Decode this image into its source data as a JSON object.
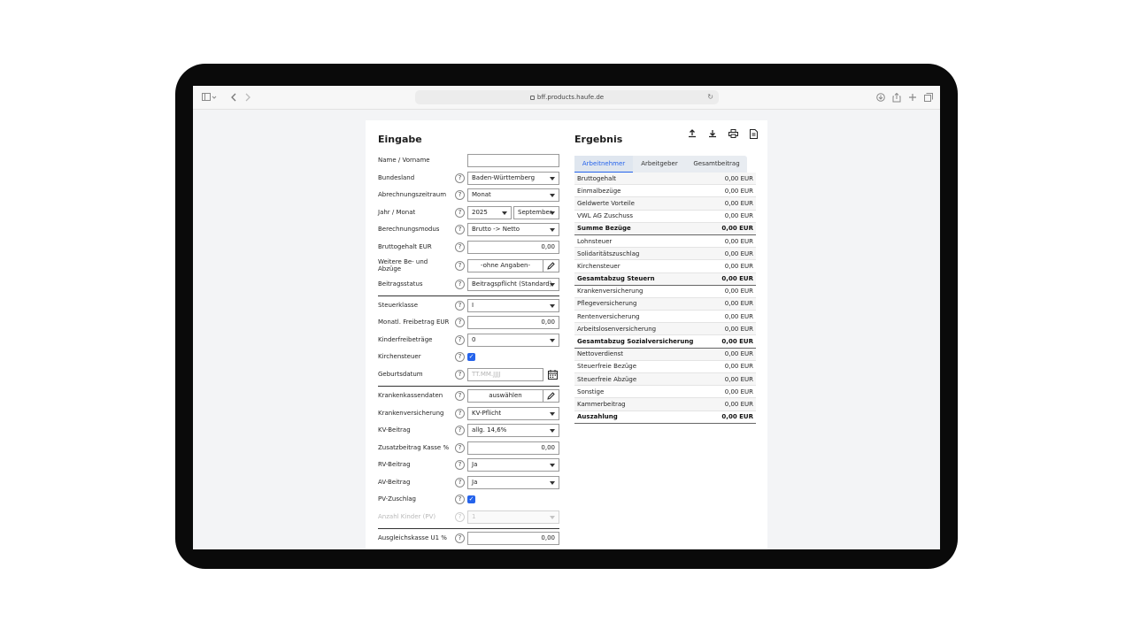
{
  "browser": {
    "url": "bff.products.haufe.de"
  },
  "input_section": {
    "title": "Eingabe",
    "fields": {
      "name": {
        "label": "Name / Vorname",
        "value": ""
      },
      "bundesland": {
        "label": "Bundesland",
        "value": "Baden-Württemberg"
      },
      "abrechnungszeitraum": {
        "label": "Abrechnungszeitraum",
        "value": "Monat"
      },
      "jahr_monat": {
        "label": "Jahr / Monat",
        "year": "2025",
        "month": "September"
      },
      "berechnungsmodus": {
        "label": "Berechnungsmodus",
        "value": "Brutto -> Netto"
      },
      "bruttogehalt": {
        "label": "Bruttogehalt EUR",
        "value": "0,00"
      },
      "weitere": {
        "label": "Weitere Be- und Abzüge",
        "value": "-ohne Angaben-"
      },
      "beitragsstatus": {
        "label": "Beitragsstatus",
        "value": "Beitragspflicht (Standard)"
      },
      "steuerklasse": {
        "label": "Steuerklasse",
        "value": "I"
      },
      "freibetrag": {
        "label": "Monatl. Freibetrag EUR",
        "value": "0,00"
      },
      "kinderfreibetraege": {
        "label": "Kinderfreibeträge",
        "value": "0"
      },
      "kirchensteuer": {
        "label": "Kirchensteuer",
        "checked": true
      },
      "geburtsdatum": {
        "label": "Geburtsdatum",
        "placeholder": "TT.MM.JJJJ"
      },
      "krankenkassendaten": {
        "label": "Krankenkassendaten",
        "value": "auswählen"
      },
      "krankenversicherung": {
        "label": "Krankenversicherung",
        "value": "KV-Pflicht"
      },
      "kv_beitrag": {
        "label": "KV-Beitrag",
        "value": "allg. 14,6%"
      },
      "zusatzbeitrag": {
        "label": "Zusatzbeitrag Kasse %",
        "value": "0,00"
      },
      "rv_beitrag": {
        "label": "RV-Beitrag",
        "value": "Ja"
      },
      "av_beitrag": {
        "label": "AV-Beitrag",
        "value": "Ja"
      },
      "pv_zuschlag": {
        "label": "PV-Zuschlag",
        "checked": true
      },
      "anzahl_kinder": {
        "label": "Anzahl Kinder (PV)",
        "value": "1"
      },
      "ausgleichskasse": {
        "label": "Ausgleichskasse U1 %",
        "value": "0,00"
      }
    },
    "help_glyph": "?"
  },
  "result_section": {
    "title": "Ergebnis",
    "tabs": [
      "Arbeitnehmer",
      "Arbeitgeber",
      "Gesamtbeitrag"
    ],
    "active_tab": "Arbeitnehmer",
    "rows": [
      {
        "label": "Bruttogehalt",
        "value": "0,00 EUR",
        "bold": false
      },
      {
        "label": "Einmalbezüge",
        "value": "0,00 EUR",
        "bold": false
      },
      {
        "label": "Geldwerte Vorteile",
        "value": "0,00 EUR",
        "bold": false
      },
      {
        "label": "VWL AG Zuschuss",
        "value": "0,00 EUR",
        "bold": false
      },
      {
        "label": "Summe Bezüge",
        "value": "0,00 EUR",
        "bold": true
      },
      {
        "label": "Lohnsteuer",
        "value": "0,00 EUR",
        "bold": false
      },
      {
        "label": "Solidaritätszuschlag",
        "value": "0,00 EUR",
        "bold": false
      },
      {
        "label": "Kirchensteuer",
        "value": "0,00 EUR",
        "bold": false
      },
      {
        "label": "Gesamtabzug Steuern",
        "value": "0,00 EUR",
        "bold": true
      },
      {
        "label": "Krankenversicherung",
        "value": "0,00 EUR",
        "bold": false
      },
      {
        "label": "Pflegeversicherung",
        "value": "0,00 EUR",
        "bold": false
      },
      {
        "label": "Rentenversicherung",
        "value": "0,00 EUR",
        "bold": false
      },
      {
        "label": "Arbeitslosenversicherung",
        "value": "0,00 EUR",
        "bold": false
      },
      {
        "label": "Gesamtabzug Sozialversicherung",
        "value": "0,00 EUR",
        "bold": true
      },
      {
        "label": "Nettoverdienst",
        "value": "0,00 EUR",
        "bold": false
      },
      {
        "label": "Steuerfreie Bezüge",
        "value": "0,00 EUR",
        "bold": false
      },
      {
        "label": "Steuerfreie Abzüge",
        "value": "0,00 EUR",
        "bold": false
      },
      {
        "label": "Sonstige",
        "value": "0,00 EUR",
        "bold": false
      },
      {
        "label": "Kammerbeitrag",
        "value": "0,00 EUR",
        "bold": false
      },
      {
        "label": "Auszahlung",
        "value": "0,00 EUR",
        "bold": true
      }
    ]
  },
  "colors": {
    "accent": "#2563eb",
    "device_frame": "#0a0a0a",
    "page_background": "#f3f4f6"
  }
}
